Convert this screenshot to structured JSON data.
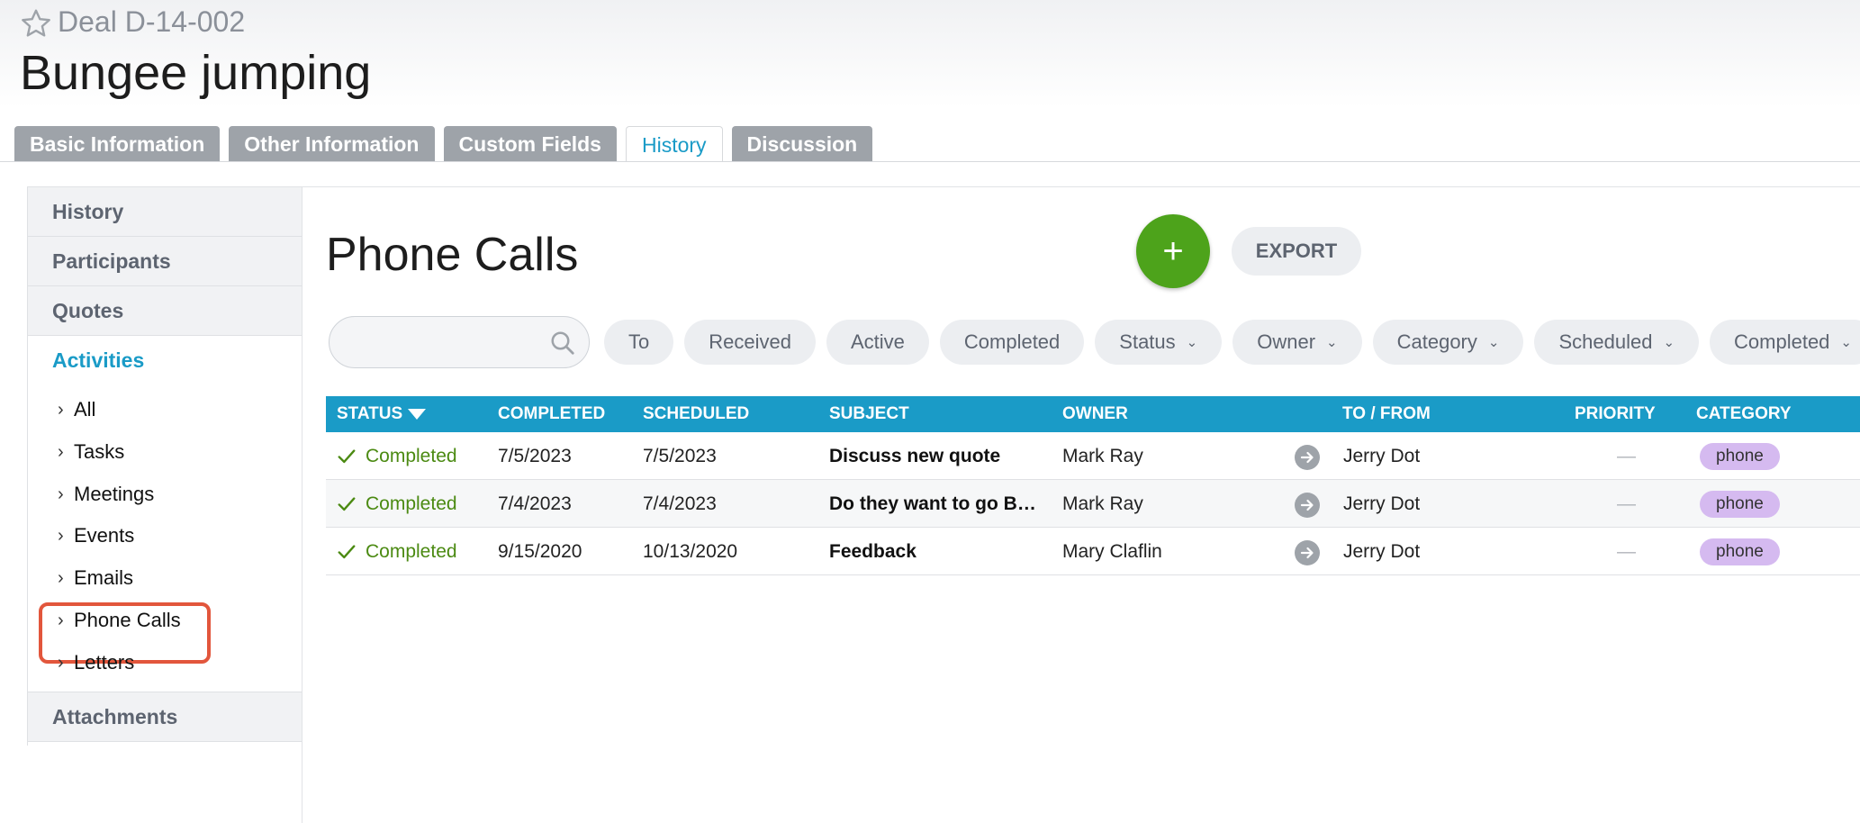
{
  "header": {
    "deal_id": "Deal D-14-002",
    "title": "Bungee jumping"
  },
  "tabs": [
    {
      "label": "Basic Information"
    },
    {
      "label": "Other Information"
    },
    {
      "label": "Custom Fields"
    },
    {
      "label": "History"
    },
    {
      "label": "Discussion"
    }
  ],
  "sidebar": {
    "items": [
      {
        "label": "History"
      },
      {
        "label": "Participants"
      },
      {
        "label": "Quotes"
      },
      {
        "label": "Activities"
      }
    ],
    "sub_items": [
      {
        "label": "All"
      },
      {
        "label": "Tasks"
      },
      {
        "label": "Meetings"
      },
      {
        "label": "Events"
      },
      {
        "label": "Emails"
      },
      {
        "label": "Phone Calls"
      },
      {
        "label": "Letters"
      }
    ],
    "attachments": "Attachments"
  },
  "main": {
    "title": "Phone Calls",
    "add_label": "+",
    "export_label": "EXPORT",
    "search": {
      "placeholder": ""
    },
    "filters": [
      {
        "label": "To"
      },
      {
        "label": "Received"
      },
      {
        "label": "Active"
      },
      {
        "label": "Completed"
      },
      {
        "label": "Status"
      },
      {
        "label": "Owner"
      },
      {
        "label": "Category"
      },
      {
        "label": "Scheduled"
      },
      {
        "label": "Completed"
      }
    ]
  },
  "table": {
    "columns": [
      "STATUS",
      "COMPLETED",
      "SCHEDULED",
      "SUBJECT",
      "OWNER",
      "TO / FROM",
      "PRIORITY",
      "CATEGORY"
    ],
    "rows": [
      {
        "status": "Completed",
        "completed": "7/5/2023",
        "scheduled": "7/5/2023",
        "subject": "Discuss new quote",
        "owner": "Mark Ray",
        "to_from": "Jerry Dot",
        "priority": "—",
        "category": "phone"
      },
      {
        "status": "Completed",
        "completed": "7/4/2023",
        "scheduled": "7/4/2023",
        "subject": "Do they want to go Bu…",
        "owner": "Mark Ray",
        "to_from": "Jerry Dot",
        "priority": "—",
        "category": "phone"
      },
      {
        "status": "Completed",
        "completed": "9/15/2020",
        "scheduled": "10/13/2020",
        "subject": "Feedback",
        "owner": "Mary Claflin",
        "to_from": "Jerry Dot",
        "priority": "—",
        "category": "phone"
      }
    ]
  },
  "colors": {
    "accent": "#1a9bc7",
    "add_button": "#4da31b",
    "status_completed": "#4b8a12",
    "category_pill": "#d5baf0",
    "highlight": "#e2563c"
  }
}
